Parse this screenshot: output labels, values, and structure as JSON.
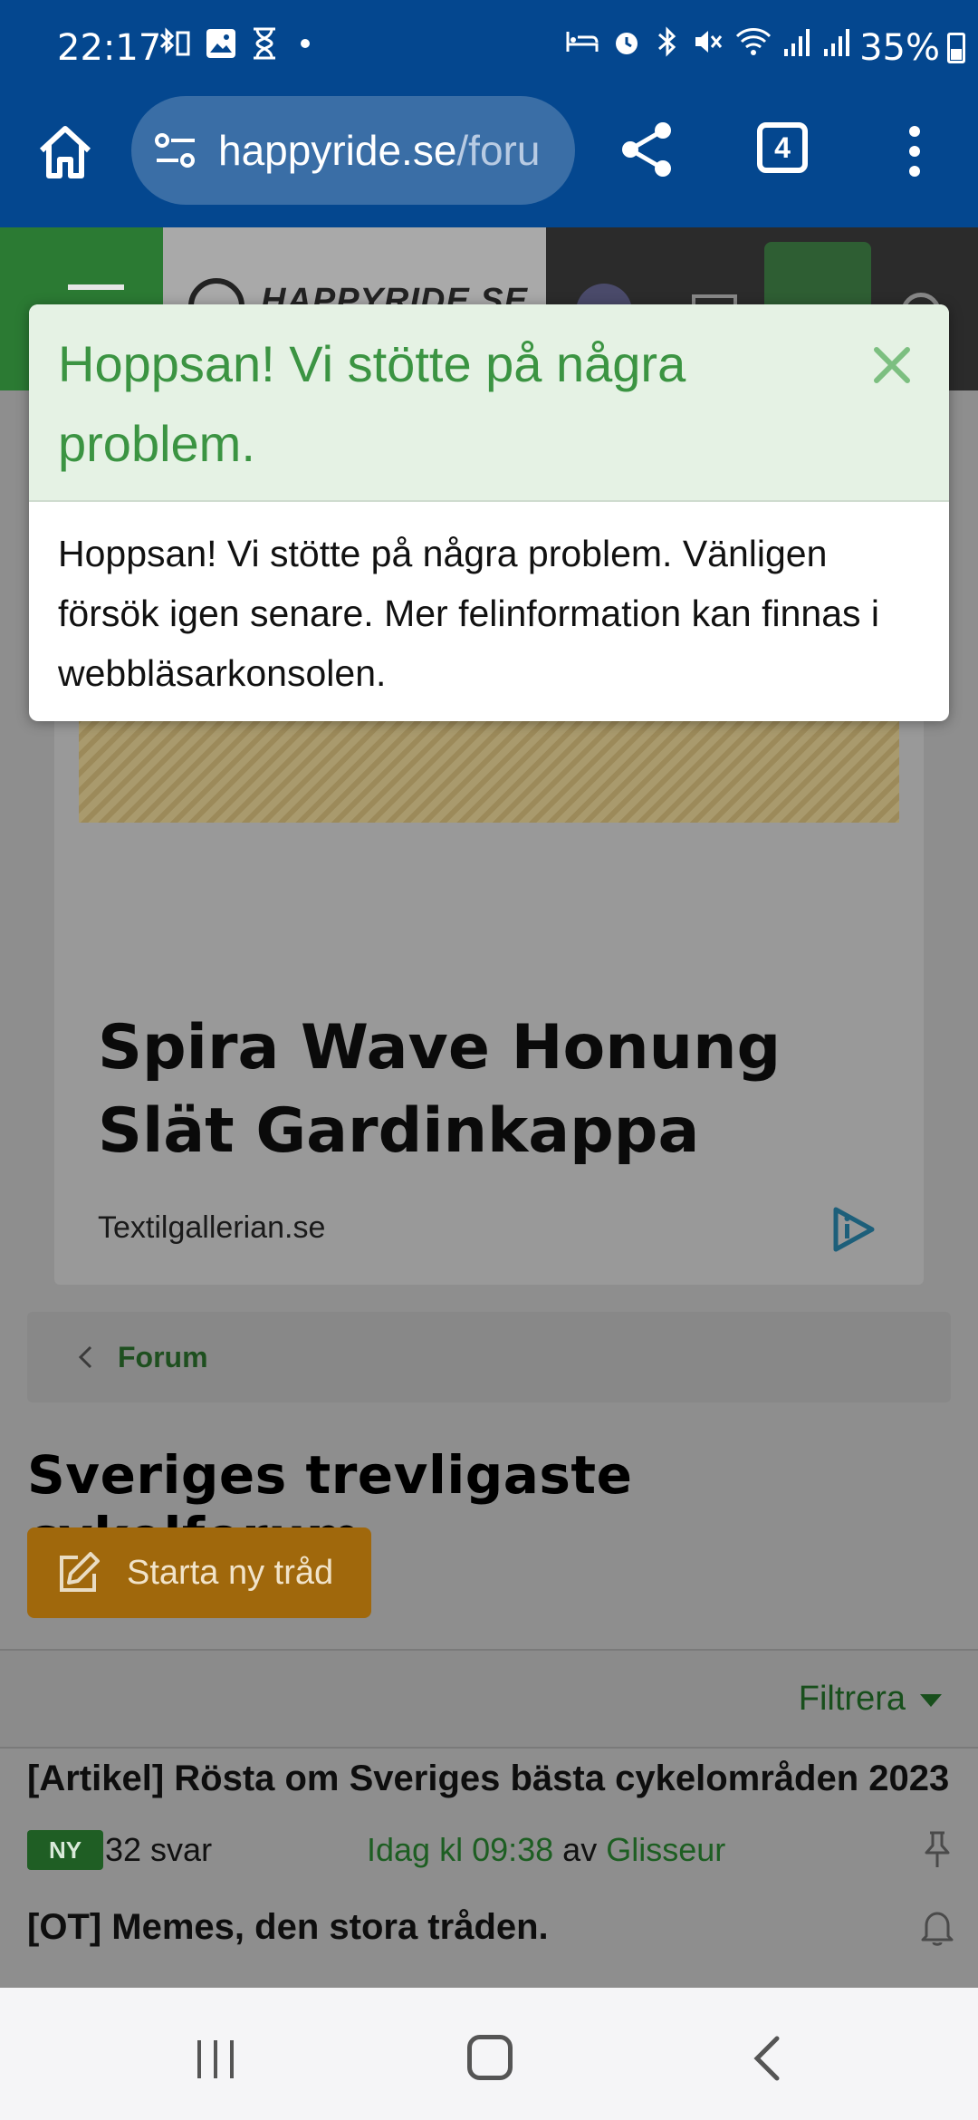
{
  "status_bar": {
    "time": "22:17",
    "battery": "35%",
    "left_icons": [
      "bluetooth-battery-icon",
      "image-icon",
      "hourglass-icon",
      "dot-icon"
    ],
    "right_icons": [
      "bed-icon",
      "alarm-icon",
      "bluetooth-icon",
      "mute-icon",
      "wifi-icon",
      "signal-icon",
      "signal-icon"
    ]
  },
  "browser": {
    "url_host": "happyride.se",
    "url_path": "/foru",
    "tab_count": "4"
  },
  "header": {
    "logo_text": "HAPPYRIDE.SE"
  },
  "ad": {
    "title": "Spira Wave Honung Slät Gardinkappa",
    "source": "Textilgallerian.se"
  },
  "breadcrumb": {
    "label": "Forum"
  },
  "forum": {
    "title": "Sveriges trevligaste cykelforum",
    "new_thread_label": "Starta ny tråd",
    "filter_label": "Filtrera"
  },
  "threads": [
    {
      "title": "[Artikel] Rösta om Sveriges bästa cykelområden 2023",
      "badge": "NY",
      "replies": "32 svar",
      "time": "Idag kl 09:38",
      "by": "av",
      "author": "Glisseur"
    },
    {
      "title": "[OT] Memes, den stora tråden."
    }
  ],
  "dialog": {
    "title": "Hoppsan! Vi stötte på några problem.",
    "body": "Hoppsan! Vi stötte på några problem. Vänligen försök igen senare. Mer felinformation kan finnas i webbläsarkonsolen."
  },
  "colors": {
    "browser_bar": "#04478f",
    "dialog_title": "#3b9442",
    "dialog_head_bg": "#e5f2e4",
    "new_thread_button": "#a0680c"
  }
}
